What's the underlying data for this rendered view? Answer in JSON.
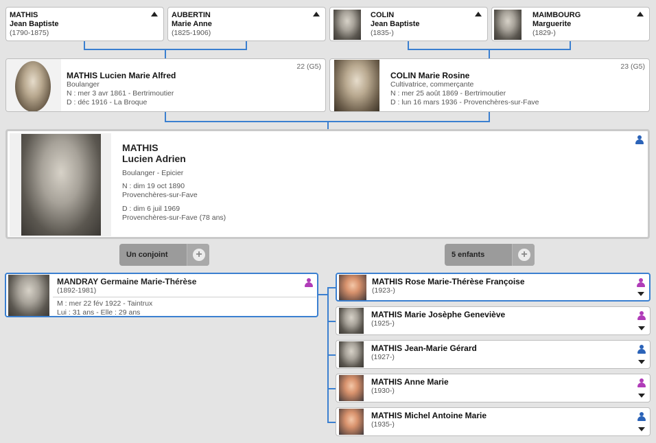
{
  "grandparents": [
    {
      "surname": "MATHIS",
      "given": "Jean Baptiste",
      "dates": "(1790-1875)",
      "has_photo": false
    },
    {
      "surname": "AUBERTIN",
      "given": "Marie Anne",
      "dates": "(1825-1906)",
      "has_photo": false
    },
    {
      "surname": "COLIN",
      "given": "Jean Baptiste",
      "dates": "(1835-)",
      "has_photo": true
    },
    {
      "surname": "MAIMBOURG",
      "given": "Marguerite",
      "dates": "(1829-)",
      "has_photo": true
    }
  ],
  "father": {
    "name": "MATHIS Lucien Marie Alfred",
    "occupation": "Boulanger",
    "birth": "N : mer 3 avr 1861 - Bertrimoutier",
    "death": "D : déc 1916 - La Broque",
    "generation": "22 (G5)"
  },
  "mother": {
    "name": "COLIN Marie Rosine",
    "occupation": "Cultivatrice, commerçante",
    "birth": "N : mer 25 août 1869 - Bertrimoutier",
    "death": "D : lun 16 mars 1936 - Provenchères-sur-Fave",
    "generation": "23 (G5)"
  },
  "main": {
    "surname": "MATHIS",
    "given": "Lucien Adrien",
    "occupation": "Boulanger - Epicier",
    "birth_date": "N : dim 19 oct 1890",
    "birth_place": "Provenchères-sur-Fave",
    "death_date": "D : dim 6 juil 1969",
    "death_place": "Provenchères-sur-Fave",
    "age": "(78 ans)"
  },
  "buttons": {
    "spouse_label": "Un conjoint",
    "children_label": "5 enfants",
    "plus": "+"
  },
  "spouse": {
    "name": "MANDRAY Germaine Marie-Thérèse",
    "dates": "(1892-1981)",
    "marriage": "M : mer 22 fév 1922 - Taintrux",
    "ages": "Lui : 31 ans - Elle : 29 ans"
  },
  "children": [
    {
      "name": "MATHIS Rose Marie-Thérèse Françoise",
      "dates": "(1923-)",
      "sex": "female"
    },
    {
      "name": "MATHIS Marie Josèphe Geneviève",
      "dates": "(1925-)",
      "sex": "female"
    },
    {
      "name": "MATHIS Jean-Marie Gérard",
      "dates": "(1927-)",
      "sex": "male"
    },
    {
      "name": "MATHIS Anne Marie",
      "dates": "(1930-)",
      "sex": "female"
    },
    {
      "name": "MATHIS Michel Antoine Marie",
      "dates": "(1935-)",
      "sex": "male"
    }
  ],
  "colors": {
    "link_line": "#3a7fd0",
    "male_icon": "#2b63b8",
    "female_icon": "#b03cb8",
    "background": "#e4e4e4"
  }
}
